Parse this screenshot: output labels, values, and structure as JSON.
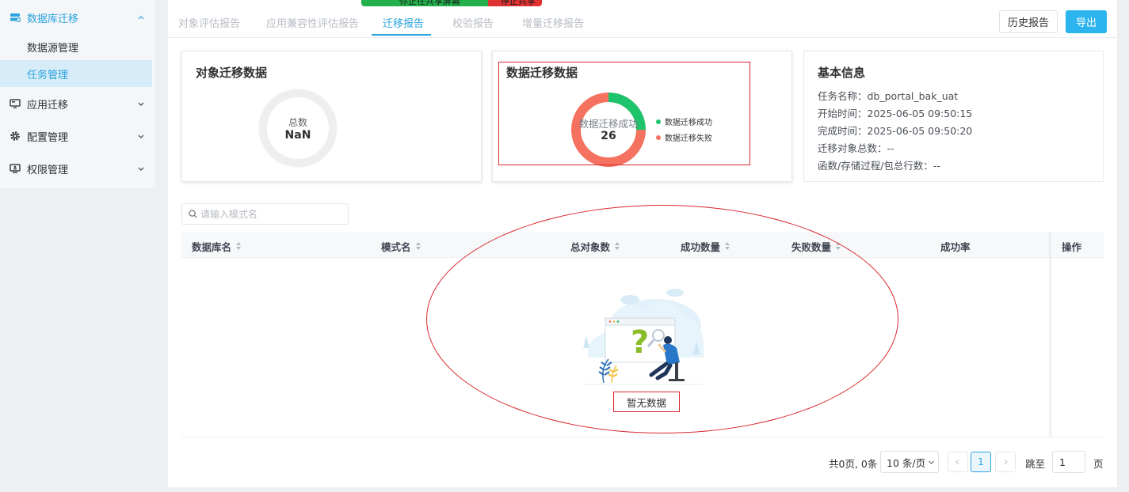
{
  "sidebar": {
    "items": [
      {
        "label": "数据库迁移",
        "icon": "database-icon",
        "expanded": true,
        "active": true
      },
      {
        "label": "应用迁移",
        "icon": "monitor-icon",
        "expanded": false
      },
      {
        "label": "配置管理",
        "icon": "gear-icon",
        "expanded": false
      },
      {
        "label": "权限管理",
        "icon": "user-monitor-icon",
        "expanded": false
      }
    ],
    "sub_items": [
      {
        "label": "数据源管理",
        "selected": false
      },
      {
        "label": "任务管理",
        "selected": true
      }
    ]
  },
  "share_banner": {
    "left_text": "你正在共享屏幕",
    "right_text": "停止共享"
  },
  "tabs": [
    {
      "label": "对象评估报告",
      "active": false
    },
    {
      "label": "应用兼容性评估报告",
      "active": false
    },
    {
      "label": "迁移报告",
      "active": true
    },
    {
      "label": "校验报告",
      "active": false
    },
    {
      "label": "增量迁移报告",
      "active": false
    }
  ],
  "toolbar": {
    "history_label": "历史报告",
    "export_label": "导出"
  },
  "object_card": {
    "title": "对象迁移数据",
    "center_label": "总数",
    "center_value": "NaN"
  },
  "data_card": {
    "title": "数据迁移数据",
    "center_label": "数据迁移成功",
    "center_value": "26",
    "segments": [
      {
        "name": "数据迁移成功",
        "value": 0.25,
        "color": "#1ec46b"
      },
      {
        "name": "数据迁移失败",
        "value": 0.75,
        "color": "#f4725f"
      }
    ]
  },
  "info_card": {
    "title": "基本信息",
    "lines": [
      "任务名称：db_portal_bak_uat",
      "开始时间：2025-06-05 09:50:15",
      "完成时间：2025-06-05 09:50:20",
      "迁移对象总数：--",
      "函数/存储过程/包总行数：--"
    ]
  },
  "search": {
    "placeholder": "请输入模式名",
    "value": ""
  },
  "table": {
    "columns": [
      "数据库名",
      "模式名",
      "总对象数",
      "成功数量",
      "失败数量",
      "成功率",
      "操作"
    ],
    "empty_text": "暂无数据"
  },
  "pagination": {
    "total_text": "共0页, 0条",
    "page_size": "10 条/页",
    "current_page": "1",
    "jump_label": "跳至",
    "jump_value": "1",
    "page_unit": "页"
  },
  "colors": {
    "accent": "#2ba3de",
    "export_button": "#2cb4ef",
    "success": "#1ec46b",
    "failure": "#f4725f",
    "annotation": "#d9262b"
  }
}
